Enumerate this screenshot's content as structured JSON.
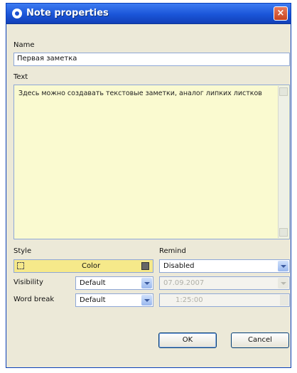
{
  "window": {
    "title": "Note properties",
    "close_glyph": "×",
    "app_icon": "note-app-icon",
    "titlebar_color": "#1a55d8"
  },
  "name_section": {
    "label": "Name",
    "value": "Первая заметка"
  },
  "text_section": {
    "label": "Text",
    "value": "Здесь можно создавать текстовые заметки, аналог липких листков",
    "background": "#fafad0"
  },
  "style_section": {
    "label": "Style",
    "color_label": "Color",
    "color_value": "#f6e98a",
    "visibility_label": "Visibility",
    "visibility_value": "Default",
    "word_break_label": "Word break",
    "word_break_value": "Default"
  },
  "remind_section": {
    "label": "Remind",
    "mode_value": "Disabled",
    "date_value": "07.09.2007",
    "time_value": "1:25:00"
  },
  "buttons": {
    "ok": "OK",
    "cancel": "Cancel"
  }
}
